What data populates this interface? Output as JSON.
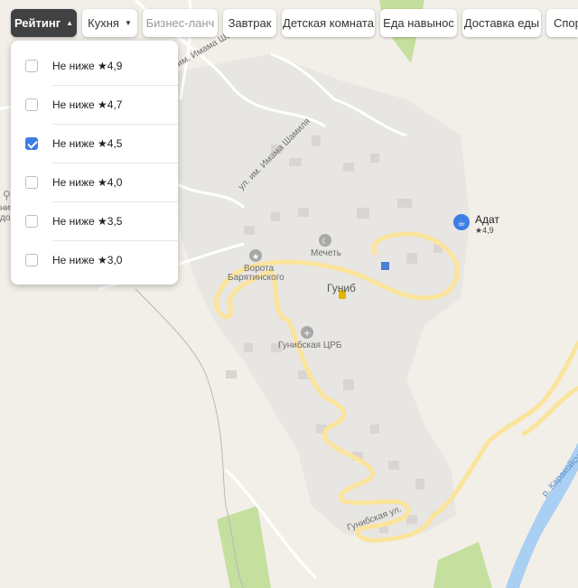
{
  "filters": {
    "chips": [
      {
        "label": "Рейтинг",
        "caret": "▲",
        "state": "active"
      },
      {
        "label": "Кухня",
        "caret": "▼",
        "state": "normal"
      },
      {
        "label": "Бизнес-ланч",
        "caret": "",
        "state": "disabled"
      },
      {
        "label": "Завтрак",
        "caret": "",
        "state": "normal"
      },
      {
        "label": "Детская комната",
        "caret": "",
        "state": "normal"
      },
      {
        "label": "Еда навынос",
        "caret": "",
        "state": "normal"
      },
      {
        "label": "Доставка еды",
        "caret": "",
        "state": "normal"
      },
      {
        "label": "Спор",
        "caret": "",
        "state": "normal"
      }
    ]
  },
  "rating_dropdown": {
    "options": [
      {
        "label": "Не ниже ★4,9",
        "checked": false
      },
      {
        "label": "Не ниже ★4,7",
        "checked": false
      },
      {
        "label": "Не ниже ★4,5",
        "checked": true
      },
      {
        "label": "Не ниже ★4,0",
        "checked": false
      },
      {
        "label": "Не ниже ★3,5",
        "checked": false
      },
      {
        "label": "Не ниже ★3,0",
        "checked": false
      }
    ]
  },
  "map": {
    "place_labels": {
      "gunib": "Гуниб",
      "mosque": "Мечеть",
      "gate_line1": "Ворота",
      "gate_line2": "Барятинского",
      "hospital": "Гунибская ЦРБ"
    },
    "street_labels": {
      "imam_shamil_1": "ул. им. Имама Шамиля",
      "imam_shamil_2": "ул. им. Имама Шамиля",
      "gunibskaya": "Гунибская ул.",
      "karakoisu": "р. Каракойсу"
    },
    "cut_labels": {
      "left_a": "ниб",
      "left_b": "до"
    },
    "poi": {
      "name": "Адат",
      "rating": "★4,9",
      "accent": "#3d7ee6"
    },
    "colors": {
      "background": "#f2efe9",
      "settlement": "#e8e6e2",
      "green": "#c5df9e",
      "road": "#fbe49b",
      "river": "#a9cff2"
    }
  }
}
